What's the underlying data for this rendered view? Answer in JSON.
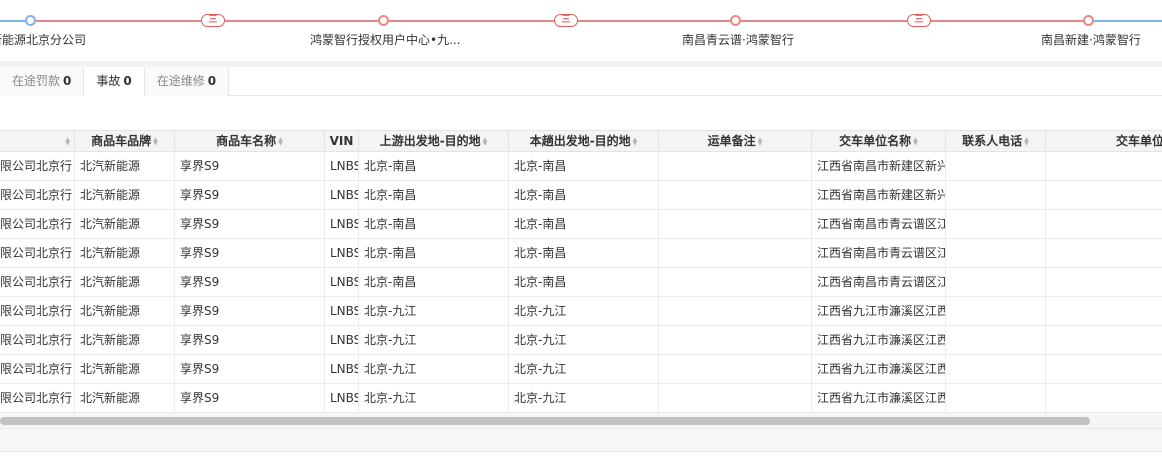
{
  "route": {
    "stops": [
      "新能源北京分公司",
      "鸿蒙智行授权用户中心•九...",
      "南昌青云谱·鸿蒙智行",
      "南昌新建·鸿蒙智行"
    ],
    "leg_icon": "三"
  },
  "tabs": [
    {
      "label": "在途罚款",
      "count": "0"
    },
    {
      "label": "事故",
      "count": "0"
    },
    {
      "label": "在途维修",
      "count": "0"
    }
  ],
  "table": {
    "columns": [
      "",
      "商品车品牌",
      "商品车名称",
      "VIN",
      "上游出发地-目的地",
      "本趟出发地-目的地",
      "运单备注",
      "交车单位名称",
      "联系人电话",
      "交车单位地"
    ],
    "rows": [
      [
        "限公司北京行",
        "北汽新能源",
        "享界S9",
        "LNBS",
        "北京-南昌",
        "北京-南昌",
        "",
        "江西省南昌市新建区新兴",
        "",
        ""
      ],
      [
        "限公司北京行",
        "北汽新能源",
        "享界S9",
        "LNBS",
        "北京-南昌",
        "北京-南昌",
        "",
        "江西省南昌市新建区新兴",
        "",
        ""
      ],
      [
        "限公司北京行",
        "北汽新能源",
        "享界S9",
        "LNBS",
        "北京-南昌",
        "北京-南昌",
        "",
        "江西省南昌市青云谱区江",
        "",
        ""
      ],
      [
        "限公司北京行",
        "北汽新能源",
        "享界S9",
        "LNBS",
        "北京-南昌",
        "北京-南昌",
        "",
        "江西省南昌市青云谱区江",
        "",
        ""
      ],
      [
        "限公司北京行",
        "北汽新能源",
        "享界S9",
        "LNBS",
        "北京-南昌",
        "北京-南昌",
        "",
        "江西省南昌市青云谱区江",
        "",
        ""
      ],
      [
        "限公司北京行",
        "北汽新能源",
        "享界S9",
        "LNBS",
        "北京-九江",
        "北京-九江",
        "",
        "江西省九江市濂溪区江西",
        "",
        ""
      ],
      [
        "限公司北京行",
        "北汽新能源",
        "享界S9",
        "LNBS",
        "北京-九江",
        "北京-九江",
        "",
        "江西省九江市濂溪区江西",
        "",
        ""
      ],
      [
        "限公司北京行",
        "北汽新能源",
        "享界S9",
        "LNBS",
        "北京-九江",
        "北京-九江",
        "",
        "江西省九江市濂溪区江西",
        "",
        ""
      ],
      [
        "限公司北京行",
        "北汽新能源",
        "享界S9",
        "LNBS",
        "北京-九江",
        "北京-九江",
        "",
        "江西省九江市濂溪区江西",
        "",
        ""
      ]
    ]
  },
  "colors": {
    "route_line": "#e8888a",
    "route_line_end": "#7cb4ea",
    "leg_icon": "#e25c5c"
  }
}
